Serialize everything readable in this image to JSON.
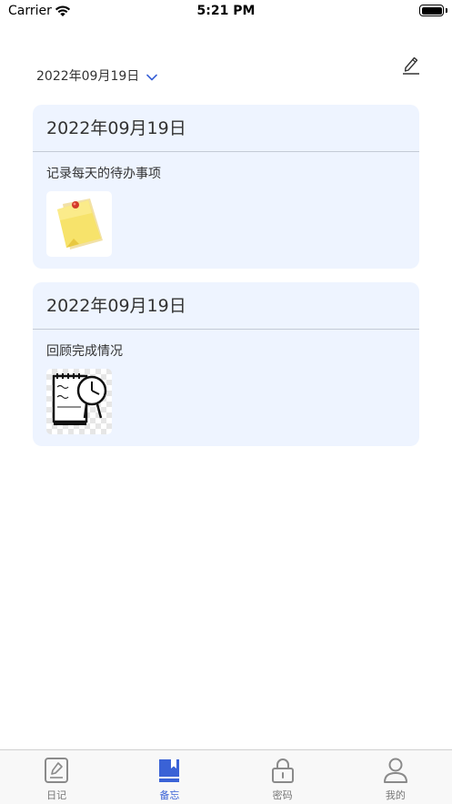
{
  "status_bar": {
    "carrier": "Carrier",
    "time": "5:21 PM"
  },
  "header": {
    "date": "2022年09月19日",
    "chevron_icon": "chevron-down-icon",
    "edit_icon": "pencil-icon"
  },
  "memos": [
    {
      "date": "2022年09月19日",
      "text": "记录每天的待办事项",
      "image": "sticky-note-image"
    },
    {
      "date": "2022年09月19日",
      "text": "回顾完成情况",
      "image": "notepad-clock-image"
    }
  ],
  "tab_bar": {
    "tabs": [
      {
        "label": "日记",
        "icon": "diary-icon",
        "active": false
      },
      {
        "label": "备忘",
        "icon": "bookmark-book-icon",
        "active": true
      },
      {
        "label": "密码",
        "icon": "lock-icon",
        "active": false
      },
      {
        "label": "我的",
        "icon": "user-icon",
        "active": false
      }
    ]
  },
  "colors": {
    "accent": "#3a62d6",
    "card_background": "#eef4ff",
    "inactive_tab": "#777777"
  }
}
